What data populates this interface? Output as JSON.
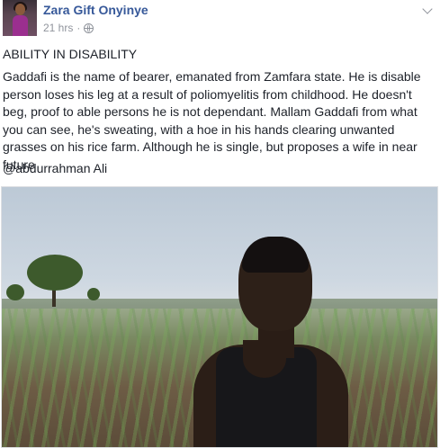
{
  "post": {
    "author": "Zara Gift Onyinye",
    "time": "21 hrs",
    "separator": "·",
    "privacy_icon": "globe-icon",
    "title": "ABILITY IN DISABILITY",
    "body": "Gaddafi is the name of bearer, emanated from Zamfara state. He is disable person loses his leg at a result of poliomyelitis from childhood. He doesn't beg, proof to able persons he is not dependant. Mallam Gaddafi from what you can see, he's sweating, with a hoe in his hands clearing unwanted grasses on his rice farm. Although he is single, but proposes a wife in near future",
    "mention": "@abdurrahman Ali"
  },
  "colors": {
    "author_link": "#365899",
    "meta_text": "#90949c",
    "body_text": "#1d2129"
  }
}
